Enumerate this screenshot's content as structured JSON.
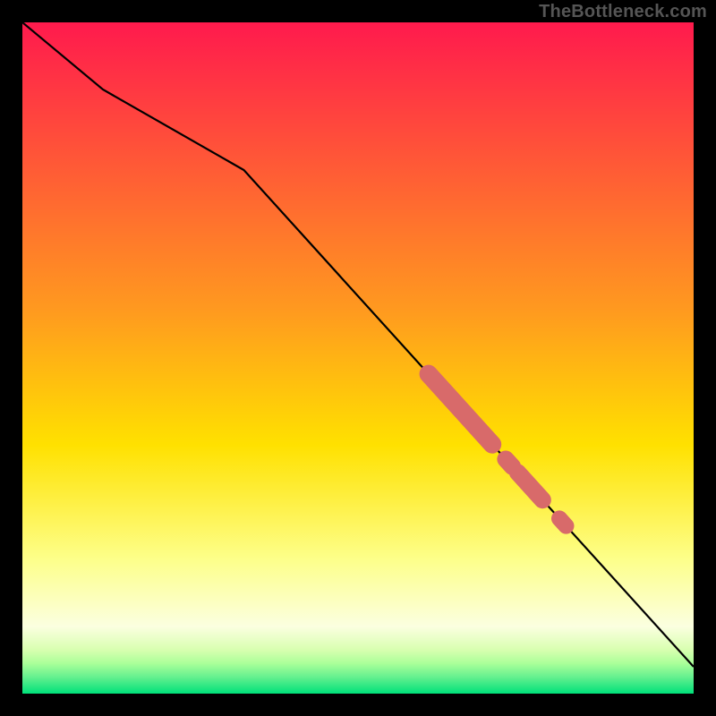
{
  "watermark": {
    "text": "TheBottleneck.com"
  },
  "colors": {
    "black": "#000000",
    "line": "#000000",
    "marker": "#d86a6a",
    "grad_top": "#ff1a4d",
    "grad_mid1": "#ff9a1f",
    "grad_mid2": "#ffe100",
    "grad_mid3": "#fdff8a",
    "grad_mid4": "#fbffe0",
    "grad_band1": "#d8ffb0",
    "grad_band2": "#aaff99",
    "grad_band3": "#66f08f",
    "grad_bottom": "#00e17a"
  },
  "chart_data": {
    "type": "line",
    "title": "",
    "xlabel": "",
    "ylabel": "",
    "xlim": [
      0,
      100
    ],
    "ylim": [
      0,
      100
    ],
    "grid": false,
    "legend": false,
    "series": [
      {
        "name": "curve",
        "x": [
          0,
          12,
          33,
          100
        ],
        "y": [
          100,
          90,
          78,
          4
        ]
      }
    ],
    "markers": [
      {
        "name": "segment-a",
        "x_start": 60.5,
        "x_end": 70.0,
        "width": 1.2
      },
      {
        "name": "dot-b",
        "x_start": 72.0,
        "x_end": 73.0,
        "width": 1.1
      },
      {
        "name": "segment-c",
        "x_start": 73.8,
        "x_end": 77.5,
        "width": 1.1
      },
      {
        "name": "dot-d",
        "x_start": 80.0,
        "x_end": 81.0,
        "width": 1.0
      }
    ],
    "background_gradient_stops": [
      {
        "offset": 0.0,
        "color_key": "grad_top"
      },
      {
        "offset": 0.43,
        "color_key": "grad_mid1"
      },
      {
        "offset": 0.63,
        "color_key": "grad_mid2"
      },
      {
        "offset": 0.8,
        "color_key": "grad_mid3"
      },
      {
        "offset": 0.9,
        "color_key": "grad_mid4"
      },
      {
        "offset": 0.935,
        "color_key": "grad_band1"
      },
      {
        "offset": 0.955,
        "color_key": "grad_band2"
      },
      {
        "offset": 0.975,
        "color_key": "grad_band3"
      },
      {
        "offset": 1.0,
        "color_key": "grad_bottom"
      }
    ]
  }
}
